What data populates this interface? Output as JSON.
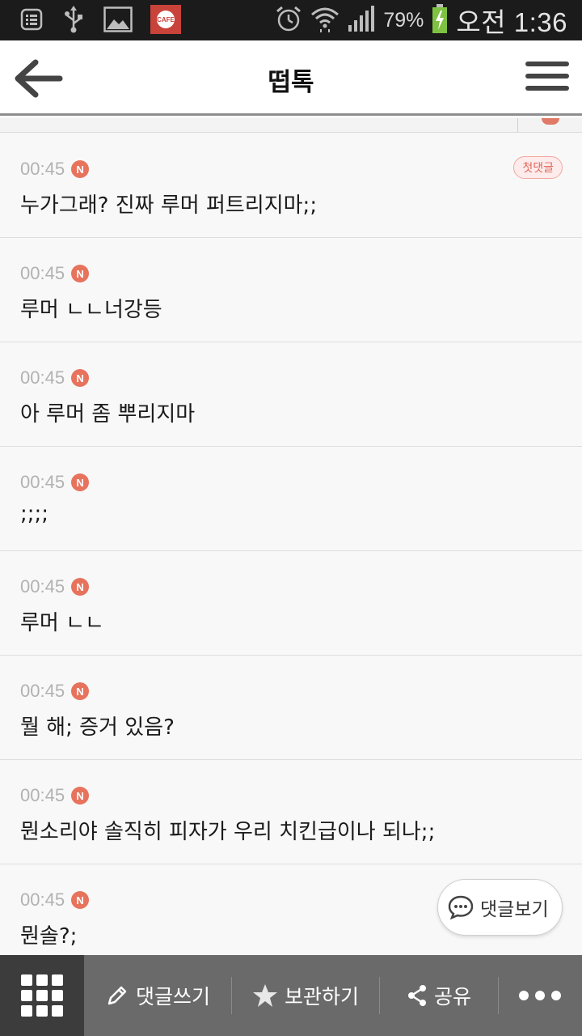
{
  "status_bar": {
    "icons_left": [
      "notification-list-icon",
      "usb-icon",
      "gallery-icon",
      "cafe-app-icon"
    ],
    "cafe_icon_text": "CAFE",
    "icons_right": [
      "alarm-icon",
      "wifi-icon",
      "signal-icon",
      "battery-charging-icon"
    ],
    "battery": "79%",
    "time": "오전 1:36"
  },
  "header": {
    "title": "떱톡"
  },
  "comments": [
    {
      "time": "00:45",
      "badge": "N",
      "text": "누가그래? 진짜 루머 퍼트리지마;;",
      "tag": "첫댓글"
    },
    {
      "time": "00:45",
      "badge": "N",
      "text": "루머 ㄴㄴ너강등"
    },
    {
      "time": "00:45",
      "badge": "N",
      "text": "아 루머 좀 뿌리지마"
    },
    {
      "time": "00:45",
      "badge": "N",
      "text": ";;;;"
    },
    {
      "time": "00:45",
      "badge": "N",
      "text": "루머 ㄴㄴ"
    },
    {
      "time": "00:45",
      "badge": "N",
      "text": "뭘 해; 증거 있음?"
    },
    {
      "time": "00:45",
      "badge": "N",
      "text": "뭔소리야 솔직히 피자가 우리 치킨급이나 되나;;"
    },
    {
      "time": "00:45",
      "badge": "N",
      "text": "뭔솔?;"
    }
  ],
  "floating": {
    "view_comments_label": "댓글보기"
  },
  "bottom_bar": {
    "write_label": "댓글쓰기",
    "bookmark_label": "보관하기",
    "share_label": "공유"
  },
  "colors": {
    "accent": "#e7735d",
    "bottom_bar": "#6a6a6a",
    "status_bar": "#1b1b1b"
  }
}
